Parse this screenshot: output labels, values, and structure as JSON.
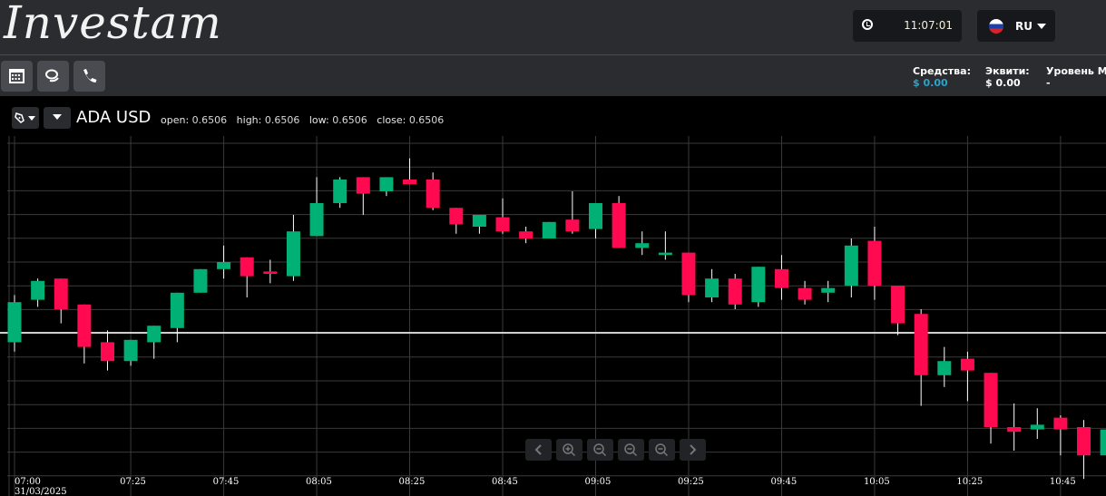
{
  "header": {
    "logo": "Investam",
    "time": "11:07:01",
    "language": "RU",
    "clock_icon": "clock-icon",
    "flag_icon": "russia-flag-icon"
  },
  "toolbar": {
    "buttons": [
      {
        "icon": "calendar-icon"
      },
      {
        "icon": "chat-icon"
      },
      {
        "icon": "phone-icon"
      }
    ]
  },
  "account": {
    "funds_label": "Средства:",
    "funds_value": "$ 0.00",
    "equity_label": "Эквити:",
    "equity_value": "$ 0.00",
    "margin_label": "Уровень Ма",
    "margin_value": "-"
  },
  "colors": {
    "up": "#00b074",
    "down": "#ff0a50",
    "accent": "#2aa3c9",
    "header_bg": "#2b2c30"
  },
  "chart_data": {
    "type": "candlestick",
    "symbol": "ADA USD",
    "ohlc_readout": {
      "open_label": "open:",
      "open": "0.6506",
      "high_label": "high:",
      "high": "0.6506",
      "low_label": "low:",
      "low": "0.6506",
      "close_label": "close:",
      "close": "0.6506"
    },
    "interval_minutes": 5,
    "start": "07:00",
    "date_label": "31/03/2025",
    "x_tick_labels": [
      "07:00",
      "07:25",
      "07:45",
      "08:05",
      "08:25",
      "08:45",
      "09:05",
      "09:25",
      "09:45",
      "10:05",
      "10:25",
      "10:45"
    ],
    "price_line": 0.6506,
    "grid": true,
    "candles": [
      [
        0.6502,
        0.6522,
        0.6498,
        0.6519
      ],
      [
        0.652,
        0.6529,
        0.6517,
        0.6528
      ],
      [
        0.6529,
        0.6529,
        0.651,
        0.6516
      ],
      [
        0.6518,
        0.6518,
        0.6493,
        0.65
      ],
      [
        0.6502,
        0.6507,
        0.649,
        0.6494
      ],
      [
        0.6494,
        0.6503,
        0.6492,
        0.6503
      ],
      [
        0.6502,
        0.6509,
        0.6495,
        0.6509
      ],
      [
        0.6508,
        0.6523,
        0.6502,
        0.6523
      ],
      [
        0.6523,
        0.6533,
        0.6523,
        0.6533
      ],
      [
        0.6533,
        0.6543,
        0.6529,
        0.6536
      ],
      [
        0.6538,
        0.6538,
        0.6521,
        0.653
      ],
      [
        0.6532,
        0.6537,
        0.6527,
        0.6531
      ],
      [
        0.653,
        0.6556,
        0.6528,
        0.6549
      ],
      [
        0.6547,
        0.6572,
        0.6547,
        0.6561
      ],
      [
        0.6561,
        0.6572,
        0.6559,
        0.6571
      ],
      [
        0.6572,
        0.6572,
        0.6556,
        0.6565
      ],
      [
        0.6566,
        0.6572,
        0.6564,
        0.6572
      ],
      [
        0.6571,
        0.658,
        0.6569,
        0.6569
      ],
      [
        0.6571,
        0.6574,
        0.6558,
        0.6559
      ],
      [
        0.6559,
        0.6559,
        0.6548,
        0.6552
      ],
      [
        0.6551,
        0.6556,
        0.6548,
        0.6556
      ],
      [
        0.6555,
        0.6563,
        0.6548,
        0.6549
      ],
      [
        0.6549,
        0.6551,
        0.6544,
        0.6546
      ],
      [
        0.6546,
        0.6553,
        0.6546,
        0.6553
      ],
      [
        0.6554,
        0.6566,
        0.6548,
        0.6549
      ],
      [
        0.655,
        0.6561,
        0.6546,
        0.6561
      ],
      [
        0.6561,
        0.6564,
        0.6542,
        0.6542
      ],
      [
        0.6542,
        0.6549,
        0.6539,
        0.6544
      ],
      [
        0.6539,
        0.6549,
        0.6537,
        0.654
      ],
      [
        0.654,
        0.654,
        0.6519,
        0.6522
      ],
      [
        0.6521,
        0.6533,
        0.6519,
        0.6529
      ],
      [
        0.6529,
        0.6531,
        0.6516,
        0.6518
      ],
      [
        0.6519,
        0.6534,
        0.6517,
        0.6534
      ],
      [
        0.6533,
        0.6539,
        0.652,
        0.6525
      ],
      [
        0.6525,
        0.6528,
        0.6518,
        0.652
      ],
      [
        0.6523,
        0.6528,
        0.6519,
        0.6525
      ],
      [
        0.6526,
        0.6546,
        0.6521,
        0.6543
      ],
      [
        0.6545,
        0.6551,
        0.652,
        0.6526
      ],
      [
        0.6526,
        0.6526,
        0.6505,
        0.651
      ],
      [
        0.6514,
        0.6516,
        0.6475,
        0.6488
      ],
      [
        0.6488,
        0.65,
        0.6483,
        0.6494
      ],
      [
        0.6495,
        0.6498,
        0.6477,
        0.649
      ],
      [
        0.6489,
        0.6489,
        0.6459,
        0.6466
      ],
      [
        0.6466,
        0.6476,
        0.6456,
        0.6464
      ],
      [
        0.6465,
        0.6474,
        0.6461,
        0.6467
      ],
      [
        0.647,
        0.6471,
        0.6454,
        0.6465
      ],
      [
        0.6466,
        0.6469,
        0.6444,
        0.6454
      ],
      [
        0.6454,
        0.6465,
        0.6454,
        0.6465
      ]
    ]
  },
  "chart_nav": [
    {
      "icon": "chevron-left-icon"
    },
    {
      "icon": "zoom-in-icon"
    },
    {
      "icon": "zoom-out-icon"
    },
    {
      "icon": "zoom-reset-icon"
    },
    {
      "icon": "zoom-fit-icon"
    },
    {
      "icon": "chevron-right-icon"
    }
  ]
}
